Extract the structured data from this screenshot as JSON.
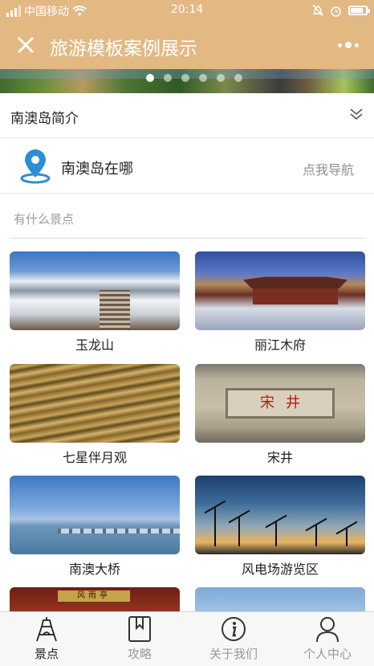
{
  "status_bar": {
    "carrier": "中国移动",
    "time": "20:14",
    "battery_level": 0.85,
    "signal_icon": "signal-icon",
    "wifi_icon": "wifi-icon",
    "mute_icon": "mute-icon",
    "alarm_icon": "alarm-icon"
  },
  "title_bar": {
    "title": "旅游模板案例展示",
    "close_icon": "close-icon",
    "more_icon": "more-icon"
  },
  "banner": {
    "dot_count": 6,
    "active_dot": 0
  },
  "intro": {
    "label": "南澳岛简介",
    "icon": "chevron-down-icon"
  },
  "location": {
    "label": "南澳岛在哪",
    "action": "点我导航",
    "icon": "location-pin-icon",
    "accent": "#2b8ed6"
  },
  "attractions": {
    "title": "有什么景点",
    "items": [
      {
        "name": "玉龙山"
      },
      {
        "name": "丽江木府"
      },
      {
        "name": "七星伴月观"
      },
      {
        "name": "宋井",
        "sign_text": "宋井"
      },
      {
        "name": "南澳大桥"
      },
      {
        "name": "风电场游览区"
      },
      {
        "name": "",
        "sign_text": "风雨亭"
      },
      {
        "name": ""
      }
    ]
  },
  "tab_bar": {
    "active": 0,
    "tabs": [
      {
        "label": "景点",
        "icon": "tower-icon"
      },
      {
        "label": "攻略",
        "icon": "bookmark-icon"
      },
      {
        "label": "关于我们",
        "icon": "info-icon"
      },
      {
        "label": "个人中心",
        "icon": "user-icon"
      }
    ]
  },
  "colors": {
    "header": "#e2b883",
    "divider": "#e3e3e3",
    "muted_text": "#9a9a9a"
  }
}
